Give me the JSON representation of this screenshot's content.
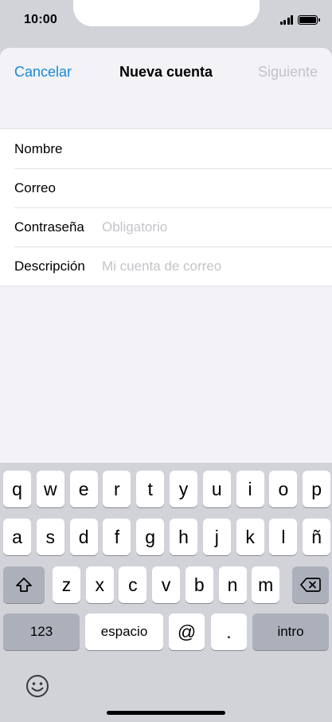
{
  "status_bar": {
    "time": "10:00",
    "signal_icon": "cellular-signal-icon",
    "battery_icon": "battery-full-icon"
  },
  "nav": {
    "cancel_label": "Cancelar",
    "title": "Nueva cuenta",
    "next_label": "Siguiente"
  },
  "form": {
    "fields": [
      {
        "label": "Nombre",
        "value": "",
        "placeholder": ""
      },
      {
        "label": "Correo",
        "value": "",
        "placeholder": ""
      },
      {
        "label": "Contraseña",
        "value": "",
        "placeholder": "Obligatorio"
      },
      {
        "label": "Descripción",
        "value": "",
        "placeholder": "Mi cuenta de correo"
      }
    ]
  },
  "keyboard": {
    "row1": [
      "q",
      "w",
      "e",
      "r",
      "t",
      "y",
      "u",
      "i",
      "o",
      "p"
    ],
    "row2": [
      "a",
      "s",
      "d",
      "f",
      "g",
      "h",
      "j",
      "k",
      "l",
      "ñ"
    ],
    "row3": [
      "z",
      "x",
      "c",
      "v",
      "b",
      "n",
      "m"
    ],
    "numbers_label": "123",
    "space_label": "espacio",
    "at_label": "@",
    "dot_label": ".",
    "return_label": "intro",
    "shift_icon": "shift-icon",
    "delete_icon": "delete-backspace-icon",
    "emoji_icon": "emoji-smiley-icon"
  },
  "colors": {
    "accent": "#1a8ad4",
    "disabled": "#c4c4c8",
    "keyboard_bg": "#d1d3d9",
    "sheet_bg": "#f2f2f7"
  }
}
